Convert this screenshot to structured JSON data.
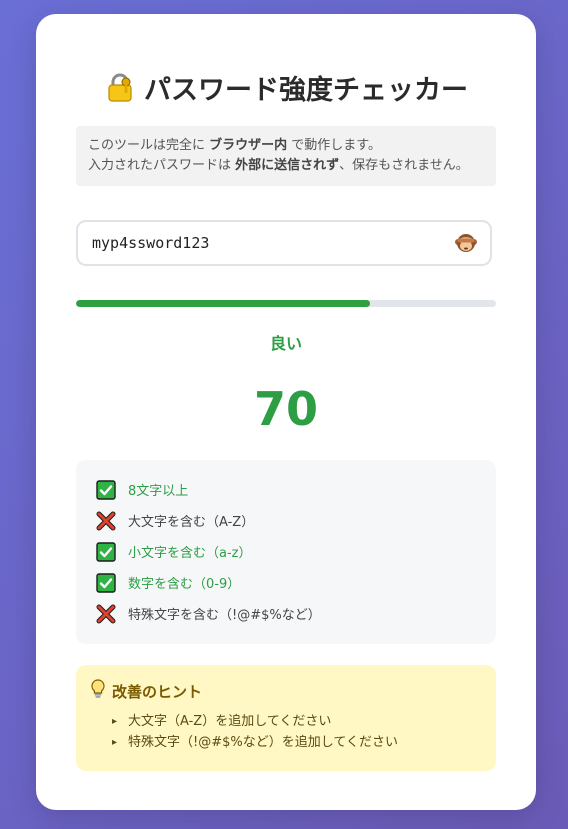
{
  "app": {
    "title": "パスワード強度チェッカー",
    "title_icon": "lock-with-key-icon"
  },
  "notice": {
    "line1_a": "このツールは完全に ",
    "line1_b": "ブラウザー内",
    "line1_c": " で動作します。",
    "line2_a": "入力されたパスワードは ",
    "line2_b": "外部に送信されず",
    "line2_c": "、保存もされません。"
  },
  "password": {
    "value": "myp4ssword123",
    "toggle_icon": "see-no-evil-monkey-icon"
  },
  "strength": {
    "progress_percent": 70,
    "label": "良い",
    "score": "70",
    "color": "#2ea043"
  },
  "checks": [
    {
      "label": "8文字以上",
      "passed": true
    },
    {
      "label": "大文字を含む（A-Z）",
      "passed": false
    },
    {
      "label": "小文字を含む（a-z）",
      "passed": true
    },
    {
      "label": "数字を含む（0-9）",
      "passed": true
    },
    {
      "label": "特殊文字を含む（!@#$%など）",
      "passed": false
    }
  ],
  "hints": {
    "title": "改善のヒント",
    "icon": "light-bulb-icon",
    "items": [
      "大文字（A-Z）を追加してください",
      "特殊文字（!@#$%など）を追加してください"
    ]
  }
}
